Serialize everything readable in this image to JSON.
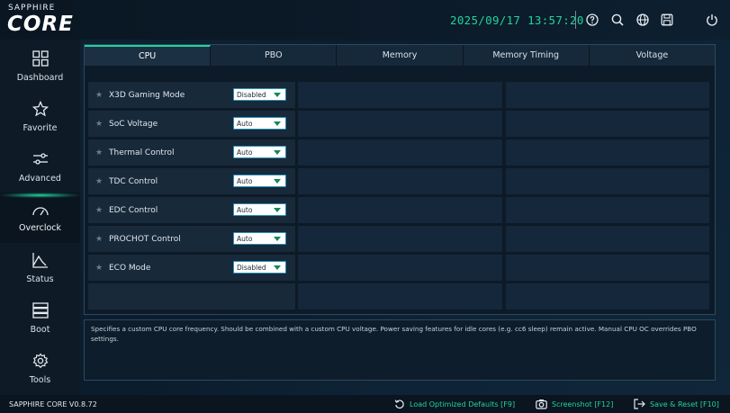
{
  "app": {
    "logo_top": "SAPPHIRE",
    "logo_main": "CORE",
    "datetime": "2025/09/17 13:57:20",
    "version": "SAPPHIRE CORE V0.8.72",
    "accent": "#22d39b"
  },
  "top_icons": [
    "help-icon",
    "search-icon",
    "globe-icon",
    "save-icon",
    "power-icon"
  ],
  "sidebar": {
    "items": [
      {
        "label": "Dashboard",
        "icon": "dashboard-icon"
      },
      {
        "label": "Favorite",
        "icon": "star-icon"
      },
      {
        "label": "Advanced",
        "icon": "sliders-icon"
      },
      {
        "label": "Overclock",
        "icon": "gauge-icon",
        "active": true
      },
      {
        "label": "Status",
        "icon": "chart-icon"
      },
      {
        "label": "Boot",
        "icon": "boot-icon"
      },
      {
        "label": "Tools",
        "icon": "gear-icon"
      }
    ]
  },
  "tabs": [
    "CPU",
    "PBO",
    "Memory",
    "Memory Timing",
    "Voltage"
  ],
  "active_tab": "CPU",
  "settings": [
    {
      "label": "X3D Gaming Mode",
      "value": "Disabled"
    },
    {
      "label": "SoC Voltage",
      "value": "Auto"
    },
    {
      "label": "Thermal Control",
      "value": "Auto"
    },
    {
      "label": "TDC Control",
      "value": "Auto"
    },
    {
      "label": "EDC Control",
      "value": "Auto"
    },
    {
      "label": "PROCHOT Control",
      "value": "Auto"
    },
    {
      "label": "ECO Mode",
      "value": "Disabled"
    }
  ],
  "help_text": "Specifies a custom CPU core frequency. Should be combined with a custom CPU voltage. Power saving features for idle cores (e.g. cc6 sleep) remain active. Manual CPU OC overrides PBO settings.",
  "status_bar": {
    "load_defaults": "Load Optimized Defaults [F9]",
    "screenshot": "Screenshot [F12]",
    "save_reset": "Save & Reset [F10]"
  }
}
